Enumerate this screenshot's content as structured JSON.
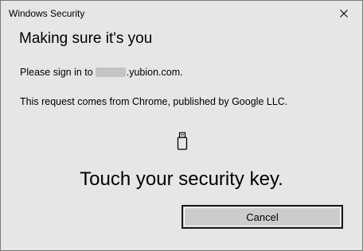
{
  "window": {
    "title": "Windows Security"
  },
  "dialog": {
    "heading": "Making sure it's you",
    "signin_prefix": "Please sign in to",
    "signin_domain": ".yubion.com.",
    "request_text": "This request comes from Chrome, published by Google LLC.",
    "prompt": "Touch your security key.",
    "cancel_label": "Cancel"
  },
  "icons": {
    "close": "close-icon",
    "key": "usb-security-key-icon"
  },
  "colors": {
    "background": "#e6e6e6",
    "button": "#cccccc",
    "border": "#7a7a7a"
  }
}
